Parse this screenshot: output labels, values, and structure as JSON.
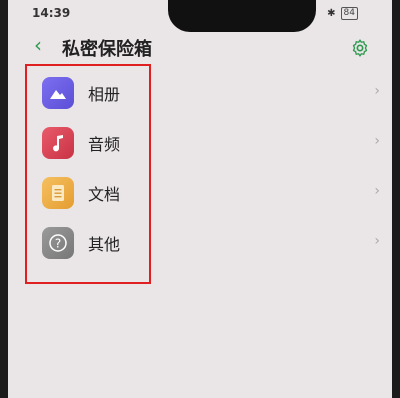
{
  "status": {
    "time": "14:39",
    "battery": "84"
  },
  "header": {
    "title": "私密保险箱"
  },
  "items": [
    {
      "label": "相册",
      "icon": "photo-icon",
      "color": "#6b5ee2"
    },
    {
      "label": "音频",
      "icon": "music-icon",
      "color": "#d94356"
    },
    {
      "label": "文档",
      "icon": "document-icon",
      "color": "#f0b04a"
    },
    {
      "label": "其他",
      "icon": "question-icon",
      "color": "#888888"
    }
  ],
  "colors": {
    "accent": "#2e9a4f",
    "highlight": "#e02020"
  }
}
